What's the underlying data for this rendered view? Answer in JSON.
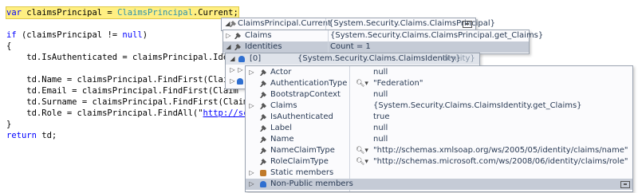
{
  "code": {
    "lines": [
      "var claimsPrincipal = ClaimsPrincipal.Current;",
      "",
      "if (claimsPrincipal != null)",
      "{",
      "    td.IsAuthenticated = claimsPrincipal.Ide",
      "",
      "    td.Name = claimsPrincipal.FindFirst(Clai",
      "    td.Email = claimsPrincipal.FindFirst(Claim",
      "    td.Surname = claimsPrincipal.FindFirst(Claim",
      "    td.Role = claimsPrincipal.FindAll(\"http://sch",
      "}",
      "return td;"
    ]
  },
  "datatip1": {
    "header_name": "ClaimsPrincipal.Current",
    "header_value": "{System.Security.Claims.ClaimsPrincipal}"
  },
  "datatip2": {
    "rows": [
      {
        "name": "Claims",
        "value": "{System.Security.Claims.ClaimsPrincipal.get_Claims}"
      },
      {
        "name": "Identities",
        "value": "Count = 1"
      }
    ]
  },
  "datatip3": {
    "name": "[0]",
    "value": "{System.Security.Claims.ClaimsIdentity}",
    "behind_fragment": "dentity}"
  },
  "datatip4": {
    "rows": [
      {
        "name": "Actor",
        "value": "null",
        "expandable": true
      },
      {
        "name": "AuthenticationType",
        "value": "\"Federation\"",
        "magnify": true
      },
      {
        "name": "BootstrapContext",
        "value": "null"
      },
      {
        "name": "Claims",
        "value": "{System.Security.Claims.ClaimsIdentity.get_Claims}",
        "expandable": true
      },
      {
        "name": "IsAuthenticated",
        "value": "true"
      },
      {
        "name": "Label",
        "value": "null"
      },
      {
        "name": "Name",
        "value": "null"
      },
      {
        "name": "NameClaimType",
        "value": "\"http://schemas.xmlsoap.org/ws/2005/05/identity/claims/name\"",
        "magnify": true
      },
      {
        "name": "RoleClaimType",
        "value": "\"http://schemas.microsoft.com/ws/2008/06/identity/claims/role\"",
        "magnify": true
      },
      {
        "name": "Static members",
        "value": "",
        "expandable": true
      },
      {
        "name": "Non-Public members",
        "value": "",
        "expandable": true
      }
    ]
  },
  "colors": {
    "keyword": "#0000ff",
    "type": "#2b91af",
    "highlight": "#ffef82"
  }
}
